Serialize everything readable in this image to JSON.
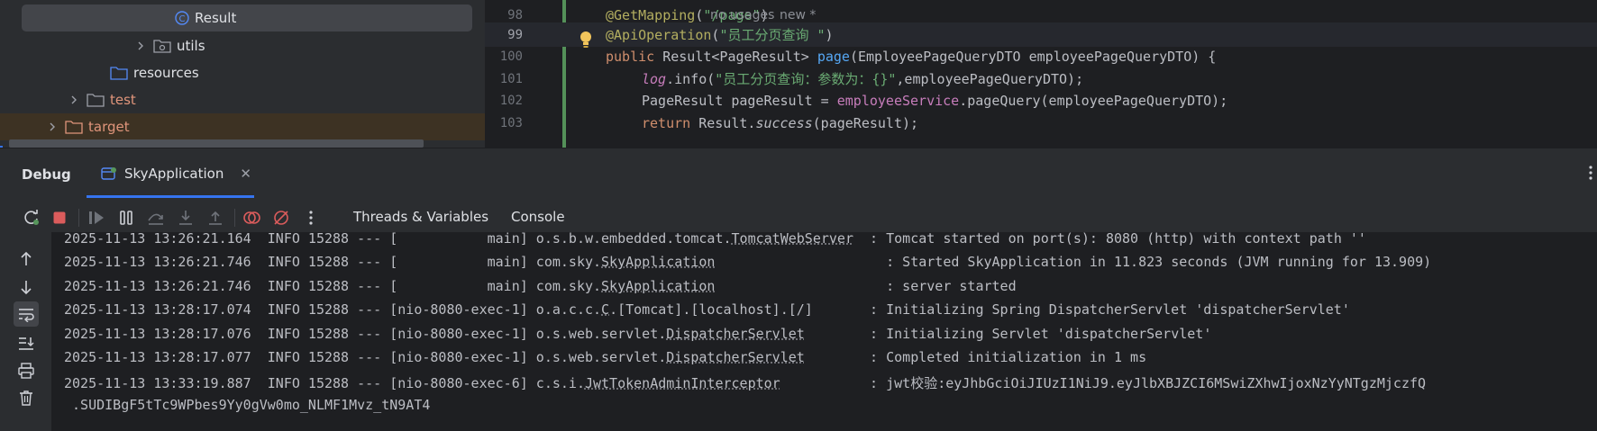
{
  "project_tree": {
    "items": [
      {
        "label": "Result",
        "kind": "class"
      },
      {
        "label": "utils",
        "kind": "package"
      },
      {
        "label": "resources",
        "kind": "folder"
      },
      {
        "label": "test",
        "kind": "folder"
      },
      {
        "label": "target",
        "kind": "folder"
      }
    ]
  },
  "editor": {
    "lines": [
      {
        "num": "98",
        "ann": "@GetMapping",
        "paren_open": "(",
        "str": "\"/page\"",
        "paren_close": ")",
        "hint1": "no usages",
        "hint2": "new *"
      },
      {
        "num": "99",
        "ann": "@ApiOperation",
        "paren_open": "(",
        "str": "\"员工分页查询 \"",
        "paren_close": ")"
      },
      {
        "num": "100",
        "kw": "public",
        "text1": " Result<PageResult> ",
        "method": "page",
        "text2": "(EmployeePageQueryDTO employeePageQueryDTO) {"
      },
      {
        "num": "101",
        "field": "log",
        "text1": ".info(",
        "str": "\"员工分页查询：参数为：{}\"",
        "text2": ",employeePageQueryDTO);"
      },
      {
        "num": "102",
        "text1": "PageResult pageResult = ",
        "field": "employeeService",
        "text2": ".pageQuery(employeePageQueryDTO);"
      },
      {
        "num": "103",
        "kw": "return",
        "text1": " Result.",
        "method": "success",
        "text2": "(pageResult);"
      }
    ]
  },
  "debug": {
    "title": "Debug",
    "run_tab": "SkyApplication",
    "tabs": [
      "Threads & Variables",
      "Console"
    ]
  },
  "console": {
    "lines": [
      {
        "a": "2025-11-13 13:26:21.164  INFO 15288 --- [           main] o.s.b.w.embedded.tomcat.",
        "u": "TomcatWebServer",
        "b": "  : Tomcat started on port(s): 8080 (http) with context path ''"
      },
      {
        "a": "2025-11-13 13:26:21.746  INFO 15288 --- [           main] com.sky.",
        "u": "SkyApplication",
        "b": "                     : Started SkyApplication in 11.823 seconds (JVM running for 13.909)"
      },
      {
        "a": "2025-11-13 13:26:21.746  INFO 15288 --- [           main] com.sky.",
        "u": "SkyApplication",
        "b": "                     : server started"
      },
      {
        "a": "2025-11-13 13:28:17.074  INFO 15288 --- [nio-8080-exec-1] o.a.c.c.",
        "u": "C",
        "b": ".[Tomcat].[localhost].[/]       : Initializing Spring DispatcherServlet 'dispatcherServlet'"
      },
      {
        "a": "2025-11-13 13:28:17.076  INFO 15288 --- [nio-8080-exec-1] o.s.web.servlet.",
        "u": "DispatcherServlet",
        "b": "        : Initializing Servlet 'dispatcherServlet'"
      },
      {
        "a": "2025-11-13 13:28:17.077  INFO 15288 --- [nio-8080-exec-1] o.s.web.servlet.",
        "u": "DispatcherServlet",
        "b": "        : Completed initialization in 1 ms"
      },
      {
        "a": "2025-11-13 13:33:19.887  INFO 15288 --- [nio-8080-exec-6] c.s.i.",
        "u": "JwtTokenAdminInterceptor",
        "b": "           : jwt校验:eyJhbGciOiJIUzI1NiJ9.eyJlbXBJZCI6MSwiZXhwIjoxNzYyNTgzMjczfQ"
      },
      {
        "a": " .SUDIBgF5tTc9WPbes9Yy0gVw0mo_NLMF1Mvz_tN9AT4",
        "u": "",
        "b": ""
      }
    ]
  },
  "colors": {
    "accent": "#3574f0",
    "annotation": "#b3ae60",
    "string": "#6aab73",
    "keyword": "#cf8e6d",
    "field": "#c77dbb",
    "method": "#56a8f5",
    "change_bar": "#549159"
  }
}
